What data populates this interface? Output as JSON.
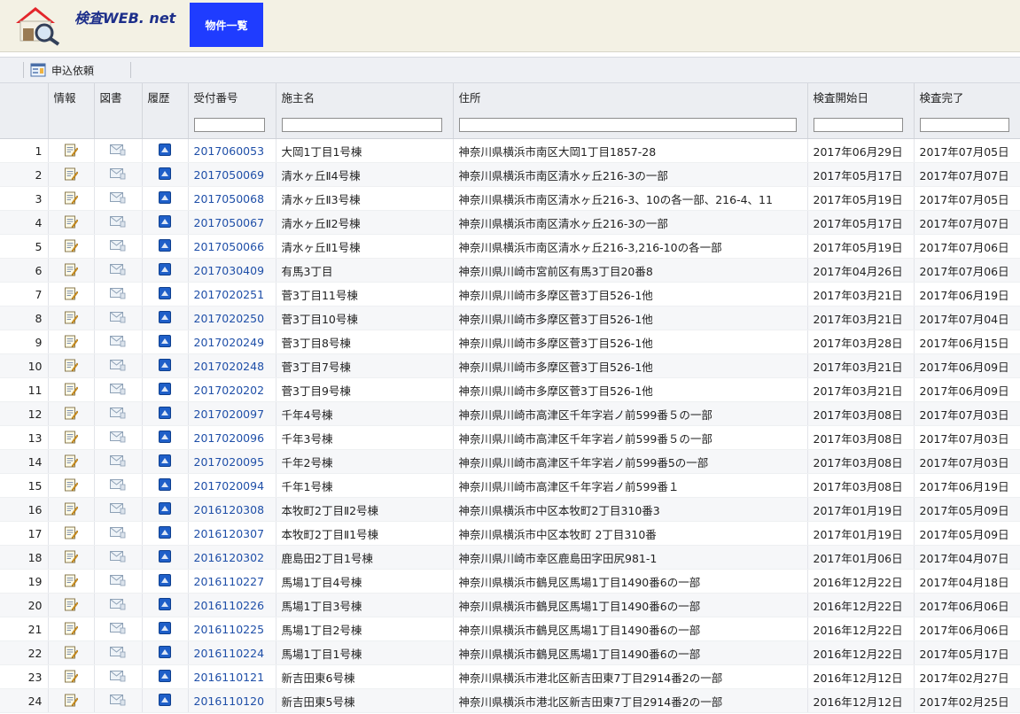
{
  "app": {
    "title": "検査WEB. net"
  },
  "nav": {
    "tabs": [
      {
        "label": "物件一覧"
      }
    ]
  },
  "toolbar": {
    "apply_label": "申込依頼"
  },
  "table": {
    "columns": [
      "",
      "情報",
      "図書",
      "履歴",
      "受付番号",
      "施主名",
      "住所",
      "検査開始日",
      "検査完了"
    ],
    "filters": {
      "receipt_no": "",
      "owner": "",
      "address": "",
      "start_date": "",
      "complete_date": ""
    },
    "rows": [
      {
        "n": "1",
        "no": "2017060053",
        "name": "大岡1丁目1号棟",
        "addr": "神奈川県横浜市南区大岡1丁目1857-28",
        "start": "2017年06月29日",
        "end": "2017年07月05日"
      },
      {
        "n": "2",
        "no": "2017050069",
        "name": "清水ヶ丘Ⅱ4号棟",
        "addr": "神奈川県横浜市南区清水ヶ丘216-3の一部",
        "start": "2017年05月17日",
        "end": "2017年07月07日"
      },
      {
        "n": "3",
        "no": "2017050068",
        "name": "清水ヶ丘Ⅱ3号棟",
        "addr": "神奈川県横浜市南区清水ヶ丘216-3、10の各一部、216-4、11",
        "start": "2017年05月19日",
        "end": "2017年07月05日"
      },
      {
        "n": "4",
        "no": "2017050067",
        "name": "清水ヶ丘Ⅱ2号棟",
        "addr": "神奈川県横浜市南区清水ヶ丘216-3の一部",
        "start": "2017年05月17日",
        "end": "2017年07月07日"
      },
      {
        "n": "5",
        "no": "2017050066",
        "name": "清水ヶ丘Ⅱ1号棟",
        "addr": "神奈川県横浜市南区清水ヶ丘216-3,216-10の各一部",
        "start": "2017年05月19日",
        "end": "2017年07月06日"
      },
      {
        "n": "6",
        "no": "2017030409",
        "name": "有馬3丁目",
        "addr": "神奈川県川崎市宮前区有馬3丁目20番8",
        "start": "2017年04月26日",
        "end": "2017年07月06日"
      },
      {
        "n": "7",
        "no": "2017020251",
        "name": "菅3丁目11号棟",
        "addr": "神奈川県川崎市多摩区菅3丁目526-1他",
        "start": "2017年03月21日",
        "end": "2017年06月19日"
      },
      {
        "n": "8",
        "no": "2017020250",
        "name": "菅3丁目10号棟",
        "addr": "神奈川県川崎市多摩区菅3丁目526-1他",
        "start": "2017年03月21日",
        "end": "2017年07月04日"
      },
      {
        "n": "9",
        "no": "2017020249",
        "name": "菅3丁目8号棟",
        "addr": "神奈川県川崎市多摩区菅3丁目526-1他",
        "start": "2017年03月28日",
        "end": "2017年06月15日"
      },
      {
        "n": "10",
        "no": "2017020248",
        "name": "菅3丁目7号棟",
        "addr": "神奈川県川崎市多摩区菅3丁目526-1他",
        "start": "2017年03月21日",
        "end": "2017年06月09日"
      },
      {
        "n": "11",
        "no": "2017020202",
        "name": "菅3丁目9号棟",
        "addr": "神奈川県川崎市多摩区菅3丁目526-1他",
        "start": "2017年03月21日",
        "end": "2017年06月09日"
      },
      {
        "n": "12",
        "no": "2017020097",
        "name": "千年4号棟",
        "addr": "神奈川県川崎市高津区千年字岩ノ前599番５の一部",
        "start": "2017年03月08日",
        "end": "2017年07月03日"
      },
      {
        "n": "13",
        "no": "2017020096",
        "name": "千年3号棟",
        "addr": "神奈川県川崎市高津区千年字岩ノ前599番５の一部",
        "start": "2017年03月08日",
        "end": "2017年07月03日"
      },
      {
        "n": "14",
        "no": "2017020095",
        "name": "千年2号棟",
        "addr": "神奈川県川崎市高津区千年字岩ノ前599番5の一部",
        "start": "2017年03月08日",
        "end": "2017年07月03日"
      },
      {
        "n": "15",
        "no": "2017020094",
        "name": "千年1号棟",
        "addr": "神奈川県川崎市高津区千年字岩ノ前599番１",
        "start": "2017年03月08日",
        "end": "2017年06月19日"
      },
      {
        "n": "16",
        "no": "2016120308",
        "name": "本牧町2丁目Ⅱ2号棟",
        "addr": "神奈川県横浜市中区本牧町2丁目310番3",
        "start": "2017年01月19日",
        "end": "2017年05月09日"
      },
      {
        "n": "17",
        "no": "2016120307",
        "name": "本牧町2丁目Ⅱ1号棟",
        "addr": "神奈川県横浜市中区本牧町 2丁目310番",
        "start": "2017年01月19日",
        "end": "2017年05月09日"
      },
      {
        "n": "18",
        "no": "2016120302",
        "name": "鹿島田2丁目1号棟",
        "addr": "神奈川県川崎市幸区鹿島田字田尻981-1",
        "start": "2017年01月06日",
        "end": "2017年04月07日"
      },
      {
        "n": "19",
        "no": "2016110227",
        "name": "馬場1丁目4号棟",
        "addr": "神奈川県横浜市鶴見区馬場1丁目1490番6の一部",
        "start": "2016年12月22日",
        "end": "2017年04月18日"
      },
      {
        "n": "20",
        "no": "2016110226",
        "name": "馬場1丁目3号棟",
        "addr": "神奈川県横浜市鶴見区馬場1丁目1490番6の一部",
        "start": "2016年12月22日",
        "end": "2017年06月06日"
      },
      {
        "n": "21",
        "no": "2016110225",
        "name": "馬場1丁目2号棟",
        "addr": "神奈川県横浜市鶴見区馬場1丁目1490番6の一部",
        "start": "2016年12月22日",
        "end": "2017年06月06日"
      },
      {
        "n": "22",
        "no": "2016110224",
        "name": "馬場1丁目1号棟",
        "addr": "神奈川県横浜市鶴見区馬場1丁目1490番6の一部",
        "start": "2016年12月22日",
        "end": "2017年05月17日"
      },
      {
        "n": "23",
        "no": "2016110121",
        "name": "新吉田東6号棟",
        "addr": "神奈川県横浜市港北区新吉田東7丁目2914番2の一部",
        "start": "2016年12月12日",
        "end": "2017年02月27日"
      },
      {
        "n": "24",
        "no": "2016110120",
        "name": "新吉田東5号棟",
        "addr": "神奈川県横浜市港北区新吉田東7丁目2914番2の一部",
        "start": "2016年12月12日",
        "end": "2017年02月25日"
      }
    ]
  },
  "icons": {
    "info": "info-edit-icon",
    "docs": "documents-mail-icon",
    "history": "history-icon"
  },
  "colors": {
    "nav_active": "#1f3cff",
    "link": "#1f4fa8",
    "logo_text": "#1d2f8a"
  }
}
